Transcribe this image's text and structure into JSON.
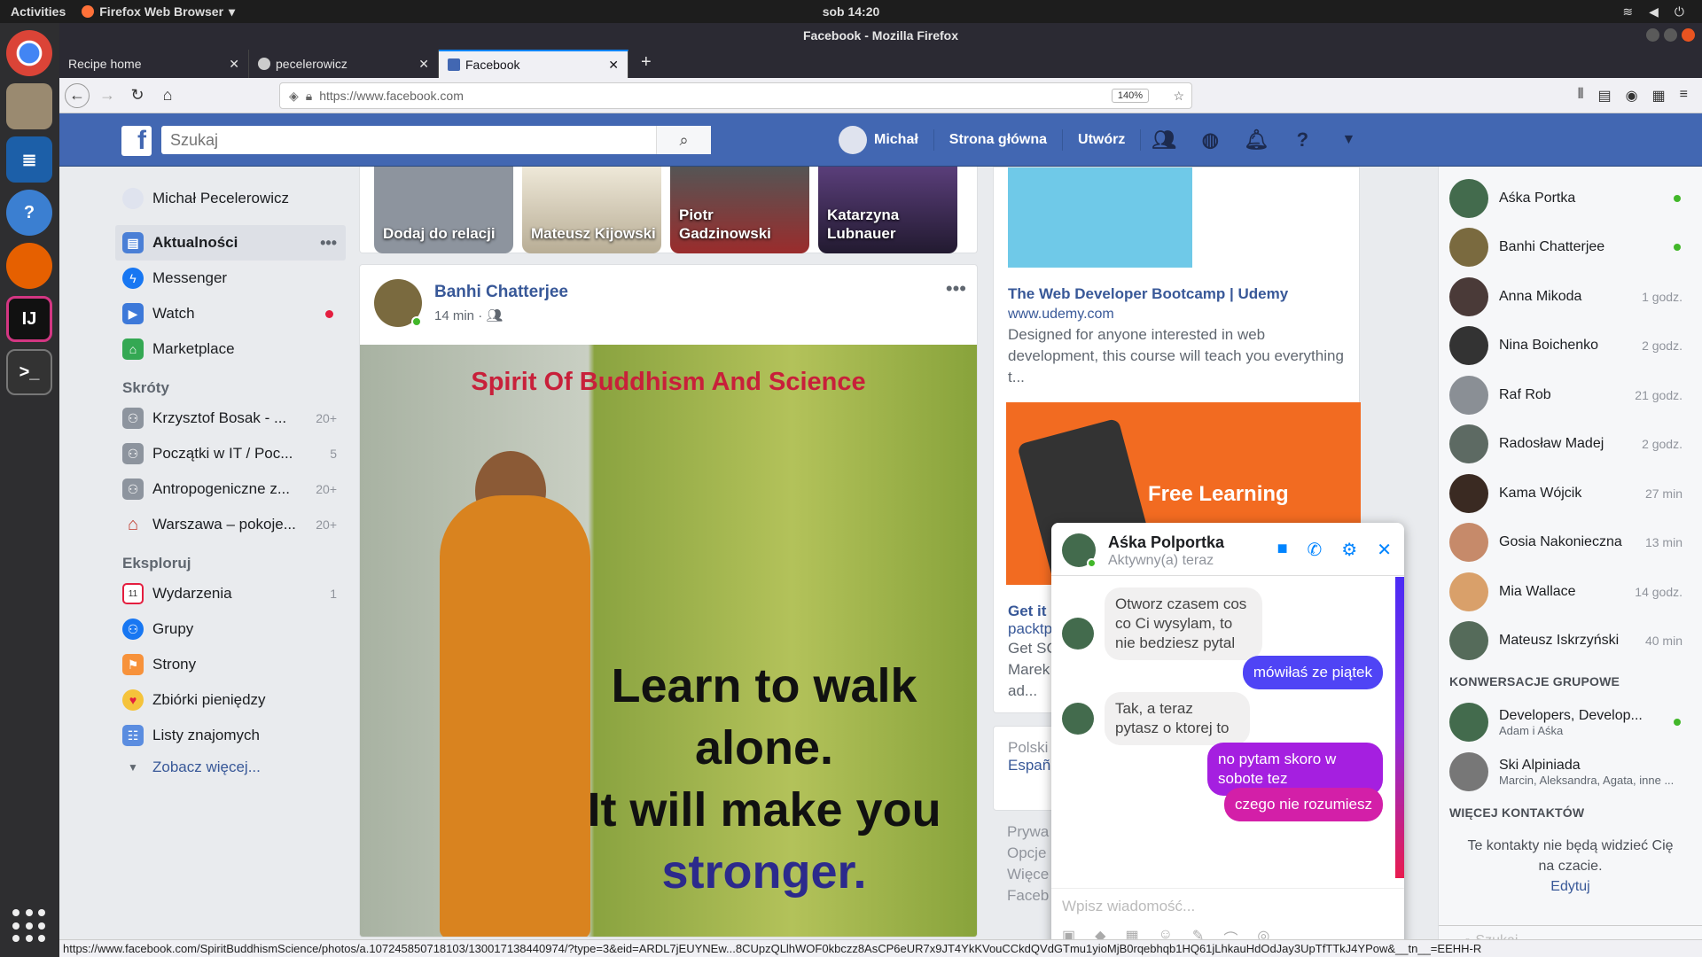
{
  "system": {
    "activities": "Activities",
    "app_name": "Firefox Web Browser",
    "clock": "sob 14:20"
  },
  "window": {
    "title": "Facebook - Mozilla Firefox"
  },
  "tabs": [
    {
      "label": "Recipe home",
      "icon": "recipe-icon"
    },
    {
      "label": "pecelerowicz",
      "icon": "github-icon"
    },
    {
      "label": "Facebook",
      "icon": "facebook-icon"
    }
  ],
  "address": {
    "url": "https://www.facebook.com",
    "zoom": "140%"
  },
  "fb": {
    "search_placeholder": "Szukaj",
    "nav": {
      "user": "Michał",
      "home": "Strona główna",
      "create": "Utwórz"
    }
  },
  "left": {
    "profile": "Michał Pecelerowicz",
    "main": [
      {
        "label": "Aktualności",
        "more": "•••"
      },
      {
        "label": "Messenger"
      },
      {
        "label": "Watch"
      },
      {
        "label": "Marketplace"
      }
    ],
    "shortcuts_title": "Skróty",
    "shortcuts": [
      {
        "label": "Krzysztof Bosak - ...",
        "count": "20+"
      },
      {
        "label": "Początki w IT / Poc...",
        "count": "5"
      },
      {
        "label": "Antropogeniczne z...",
        "count": "20+"
      },
      {
        "label": "Warszawa – pokoje...",
        "count": "20+"
      }
    ],
    "explore_title": "Eksploruj",
    "explore": [
      {
        "label": "Wydarzenia",
        "count": "1"
      },
      {
        "label": "Grupy",
        "count": ""
      },
      {
        "label": "Strony",
        "count": ""
      },
      {
        "label": "Zbiórki pieniędzy",
        "count": ""
      },
      {
        "label": "Listy znajomych",
        "count": ""
      }
    ],
    "see_more": "Zobacz więcej..."
  },
  "stories": [
    {
      "label": "Dodaj do relacji",
      "color": "#8d949e"
    },
    {
      "label": "Mateusz Kijowski",
      "color": "#e8e2d4"
    },
    {
      "label": "Piotr Gadzinowski",
      "color": "#6c6c6c"
    },
    {
      "label": "Katarzyna Lubnauer",
      "color": "#2d2340"
    }
  ],
  "post": {
    "author": "Banhi Chatterjee",
    "time": "14 min ·",
    "more": "•••",
    "image_title": "Spirit Of Buddhism And Science",
    "quote_l1": "Learn to walk",
    "quote_l2": "alone.",
    "quote_l3": "It will make you",
    "quote_l4": "stronger."
  },
  "ads": {
    "ad1_title": "The Web Developer Bootcamp | Udemy",
    "ad1_url": "www.udemy.com",
    "ad1_text": "Designed for anyone interested in web development, this course will teach you everything t...",
    "ad2_banner": "Free Learning",
    "ad2_title": "Get it",
    "ad2_url": "packtp",
    "ad2_text_l1": "Get SC",
    "ad2_text_l2": "Marek",
    "ad2_text_l3": "ad...",
    "lang_current": "Polski",
    "lang_other": "Españ",
    "footer_l1": "Prywa",
    "footer_l2": "Opcje",
    "footer_l3": "Więce",
    "footer_l4": "Faceb"
  },
  "chat": {
    "contacts": [
      {
        "name": "Aśka Portka",
        "time": "",
        "online": true,
        "color": "#436b4d"
      },
      {
        "name": "Banhi Chatterjee",
        "time": "",
        "online": true,
        "color": "#7a6a3f"
      },
      {
        "name": "Anna Mikoda",
        "time": "1 godz.",
        "online": false,
        "color": "#4a3a38"
      },
      {
        "name": "Nina Boichenko",
        "time": "2 godz.",
        "online": false,
        "color": "#333333"
      },
      {
        "name": "Raf Rob",
        "time": "21 godz.",
        "online": false,
        "color": "#8a8f95"
      },
      {
        "name": "Radosław Madej",
        "time": "2 godz.",
        "online": false,
        "color": "#5d6a63"
      },
      {
        "name": "Kama Wójcik",
        "time": "27 min",
        "online": false,
        "color": "#3a2a22"
      },
      {
        "name": "Gosia Nakonieczna",
        "time": "13 min",
        "online": false,
        "color": "#c68a6a"
      },
      {
        "name": "Mia Wallace",
        "time": "14 godz.",
        "online": false,
        "color": "#d9a06a"
      },
      {
        "name": "Mateusz Iskrzyński",
        "time": "40 min",
        "online": false,
        "color": "#556b5a"
      }
    ],
    "groups_title": "KONWERSACJE GRUPOWE",
    "groups": [
      {
        "name": "Developers, Develop...",
        "sub": "Adam i Aśka",
        "online": true
      },
      {
        "name": "Ski Alpiniada",
        "sub": "Marcin, Aleksandra, Agata, inne ...",
        "online": false
      }
    ],
    "more_title": "WIĘCEJ KONTAKTÓW",
    "no_contacts": "Te kontakty nie będą widzieć Cię na czacie.",
    "edit": "Edytuj",
    "search_placeholder": "Szukaj"
  },
  "messenger": {
    "name": "Aśka Polportka",
    "status": "Aktywny(a) teraz",
    "messages": [
      {
        "dir": "in",
        "text": "Otworz czasem cos co Ci wysylam, to nie bedziesz pytal"
      },
      {
        "dir": "out",
        "text": "mówiłaś ze piątek"
      },
      {
        "dir": "in",
        "text": "Tak, a teraz pytasz o ktorej to"
      },
      {
        "dir": "out",
        "text": "no pytam skoro w sobote tez"
      },
      {
        "dir": "out",
        "text": "czego nie rozumiesz"
      }
    ],
    "input_placeholder": "Wpisz wiadomość..."
  },
  "statusbar": {
    "url": "https://www.facebook.com/SpiritBuddhismScience/photos/a.107245850718103/130017138440974/?type=3&eid=ARDL7jEUYNEw...8CUpzQLlhWOF0kbczz8AsCP6eUR7x9JT4YkKVouCCkdQVdGTmu1yioMjB0rqebhqb1HQ61jLhkauHdOdJay3UpTfTTkJ4YPow&__tn__=EEHH-R"
  }
}
